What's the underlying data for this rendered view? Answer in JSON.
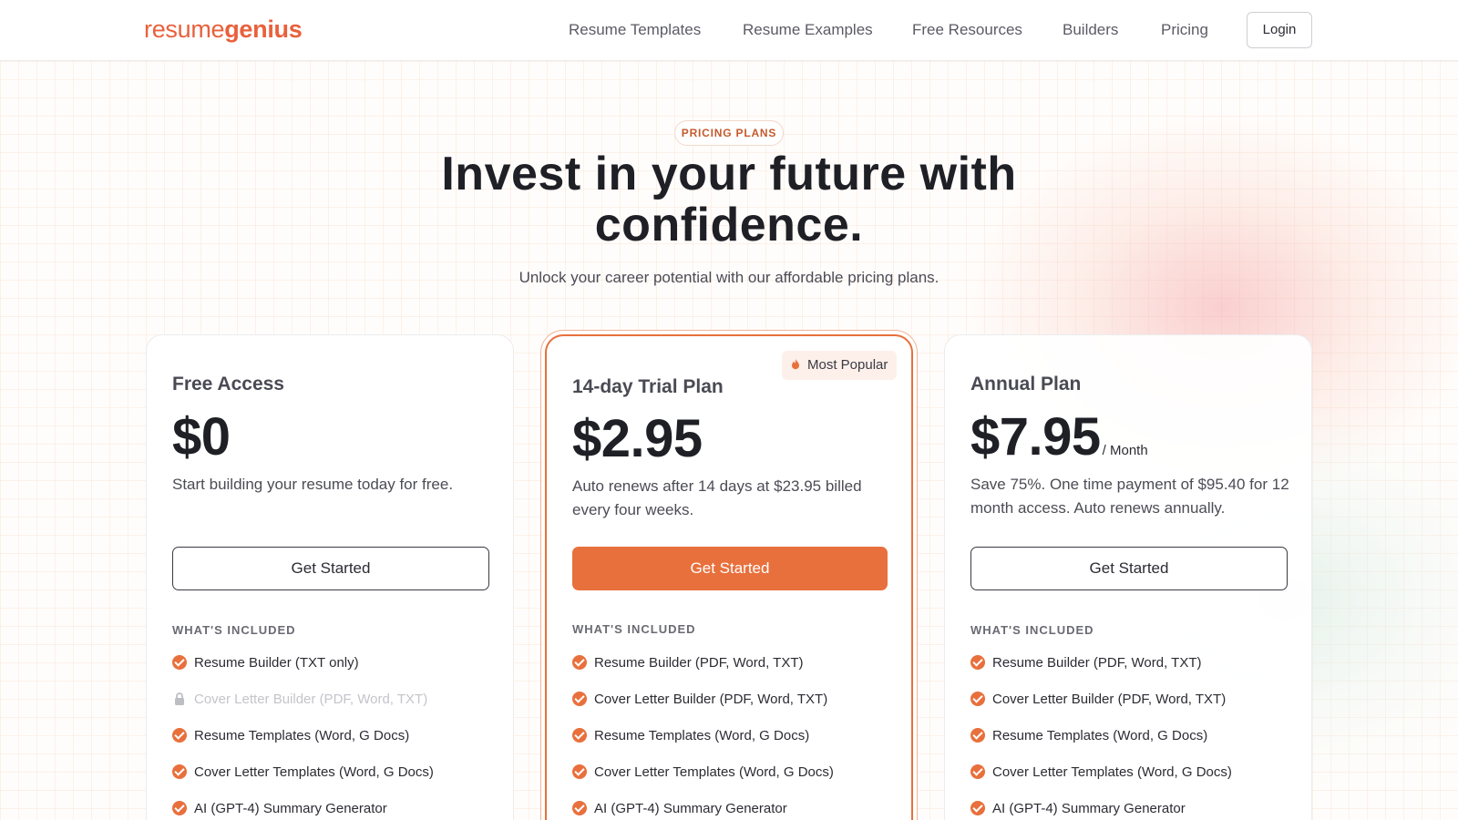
{
  "header": {
    "logo": {
      "part1": "resume",
      "part2": "genius"
    },
    "nav": [
      {
        "label": "Resume Templates"
      },
      {
        "label": "Resume Examples"
      },
      {
        "label": "Free Resources"
      },
      {
        "label": "Builders"
      },
      {
        "label": "Pricing"
      }
    ],
    "login_label": "Login"
  },
  "hero": {
    "badge": "PRICING PLANS",
    "title_line1": "Invest in your future with",
    "title_line2": "confidence.",
    "subtitle": "Unlock your career potential with our affordable pricing plans."
  },
  "plans": [
    {
      "name": "Free Access",
      "price": "$0",
      "price_unit": "",
      "description": "Start building your resume today for free.",
      "cta_label": "Get Started",
      "included_label": "WHAT'S INCLUDED",
      "features": [
        {
          "label": "Resume Builder (TXT only)",
          "included": true
        },
        {
          "label": "Cover Letter Builder (PDF, Word, TXT)",
          "included": false
        },
        {
          "label": "Resume Templates (Word, G Docs)",
          "included": true
        },
        {
          "label": "Cover Letter Templates (Word, G Docs)",
          "included": true
        },
        {
          "label": "AI (GPT-4) Summary Generator",
          "included": true
        }
      ]
    },
    {
      "name": "14-day Trial Plan",
      "badge": "Most Popular",
      "price": "$2.95",
      "price_unit": "",
      "description": "Auto renews after 14 days at $23.95 billed every four weeks.",
      "cta_label": "Get Started",
      "included_label": "WHAT'S INCLUDED",
      "features": [
        {
          "label": "Resume Builder (PDF, Word, TXT)",
          "included": true
        },
        {
          "label": "Cover Letter Builder (PDF, Word, TXT)",
          "included": true
        },
        {
          "label": "Resume Templates (Word, G Docs)",
          "included": true
        },
        {
          "label": "Cover Letter Templates (Word, G Docs)",
          "included": true
        },
        {
          "label": "AI (GPT-4) Summary Generator",
          "included": true
        }
      ]
    },
    {
      "name": "Annual Plan",
      "price": "$7.95",
      "price_unit": "/ Month",
      "description": "Save 75%. One time payment of $95.40 for 12 month access. Auto renews annually.",
      "cta_label": "Get Started",
      "included_label": "WHAT'S INCLUDED",
      "features": [
        {
          "label": "Resume Builder (PDF, Word, TXT)",
          "included": true
        },
        {
          "label": "Cover Letter Builder (PDF, Word, TXT)",
          "included": true
        },
        {
          "label": "Resume Templates (Word, G Docs)",
          "included": true
        },
        {
          "label": "Cover Letter Templates (Word, G Docs)",
          "included": true
        },
        {
          "label": "AI (GPT-4) Summary Generator",
          "included": true
        }
      ]
    }
  ],
  "colors": {
    "accent": "#e8703c",
    "logo": "#e8613c",
    "text": "#2b2b33"
  }
}
